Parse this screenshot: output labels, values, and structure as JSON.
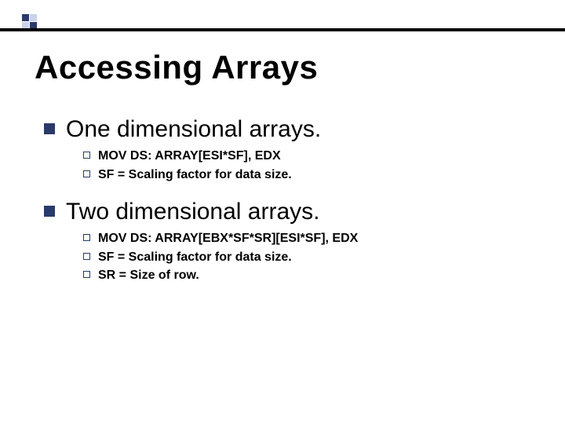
{
  "title": "Accessing Arrays",
  "sections": [
    {
      "heading": "One dimensional arrays.",
      "items": [
        "MOV DS: ARRAY[ESI*SF], EDX",
        "SF = Scaling factor for data size."
      ]
    },
    {
      "heading": "Two dimensional arrays.",
      "items": [
        "MOV DS: ARRAY[EBX*SF*SR][ESI*SF], EDX",
        "SF = Scaling factor for data size.",
        "SR = Size of row."
      ]
    }
  ]
}
